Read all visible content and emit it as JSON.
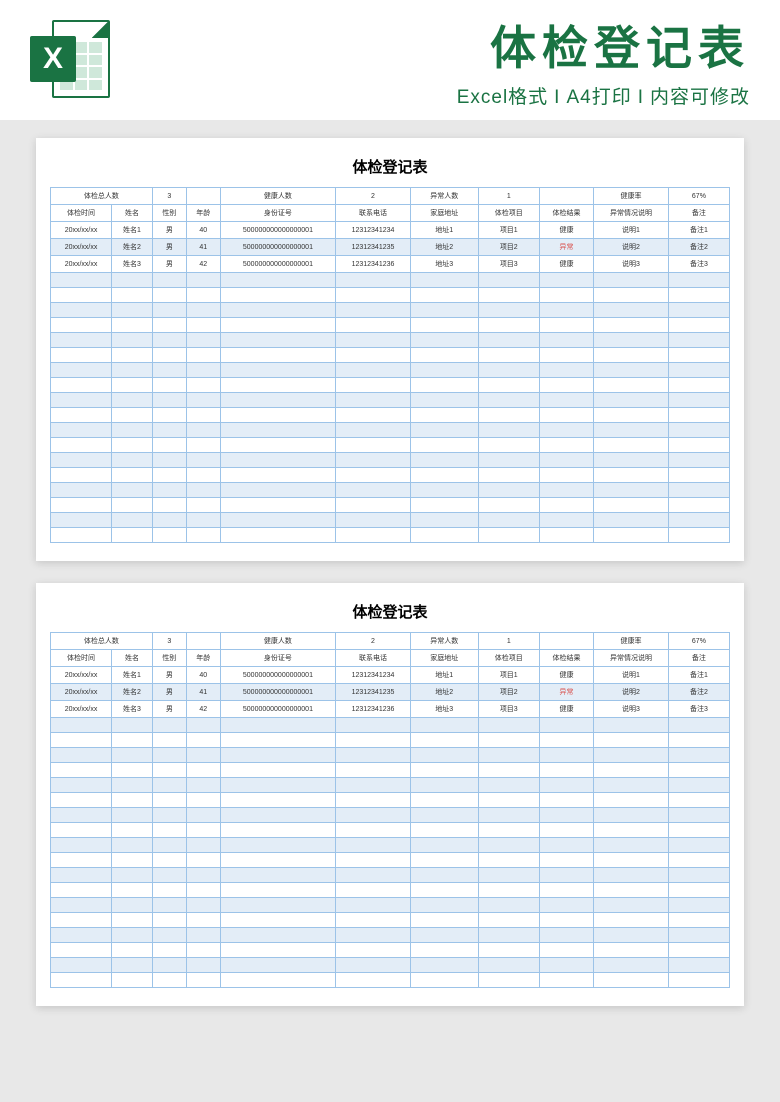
{
  "banner": {
    "title": "体检登记表",
    "sub_parts": [
      "Excel格式",
      "A4打印",
      "内容可修改"
    ],
    "x_badge": "X"
  },
  "sheet": {
    "title": "体检登记表",
    "summary": {
      "total_label": "体检总人数",
      "total_value": "3",
      "healthy_label": "健康人数",
      "healthy_value": "2",
      "abnormal_label": "异常人数",
      "abnormal_value": "1",
      "rate_label": "健康率",
      "rate_value": "67%"
    },
    "headers": {
      "date": "体检时间",
      "name": "姓名",
      "gender": "性别",
      "age": "年龄",
      "id": "身份证号",
      "phone": "联系电话",
      "addr": "家庭地址",
      "item": "体检项目",
      "result": "体检结果",
      "note": "异常情况说明",
      "remark": "备注"
    },
    "rows": [
      {
        "date": "20xx/xx/xx",
        "name": "姓名1",
        "gender": "男",
        "age": "40",
        "id": "500000000000000001",
        "phone": "12312341234",
        "addr": "地址1",
        "item": "项目1",
        "result": "健康",
        "result_abnormal": false,
        "note": "说明1",
        "remark": "备注1"
      },
      {
        "date": "20xx/xx/xx",
        "name": "姓名2",
        "gender": "男",
        "age": "41",
        "id": "500000000000000001",
        "phone": "12312341235",
        "addr": "地址2",
        "item": "项目2",
        "result": "异常",
        "result_abnormal": true,
        "note": "说明2",
        "remark": "备注2"
      },
      {
        "date": "20xx/xx/xx",
        "name": "姓名3",
        "gender": "男",
        "age": "42",
        "id": "500000000000000001",
        "phone": "12312341236",
        "addr": "地址3",
        "item": "项目3",
        "result": "健康",
        "result_abnormal": false,
        "note": "说明3",
        "remark": "备注3"
      }
    ],
    "empty_rows": 18
  }
}
